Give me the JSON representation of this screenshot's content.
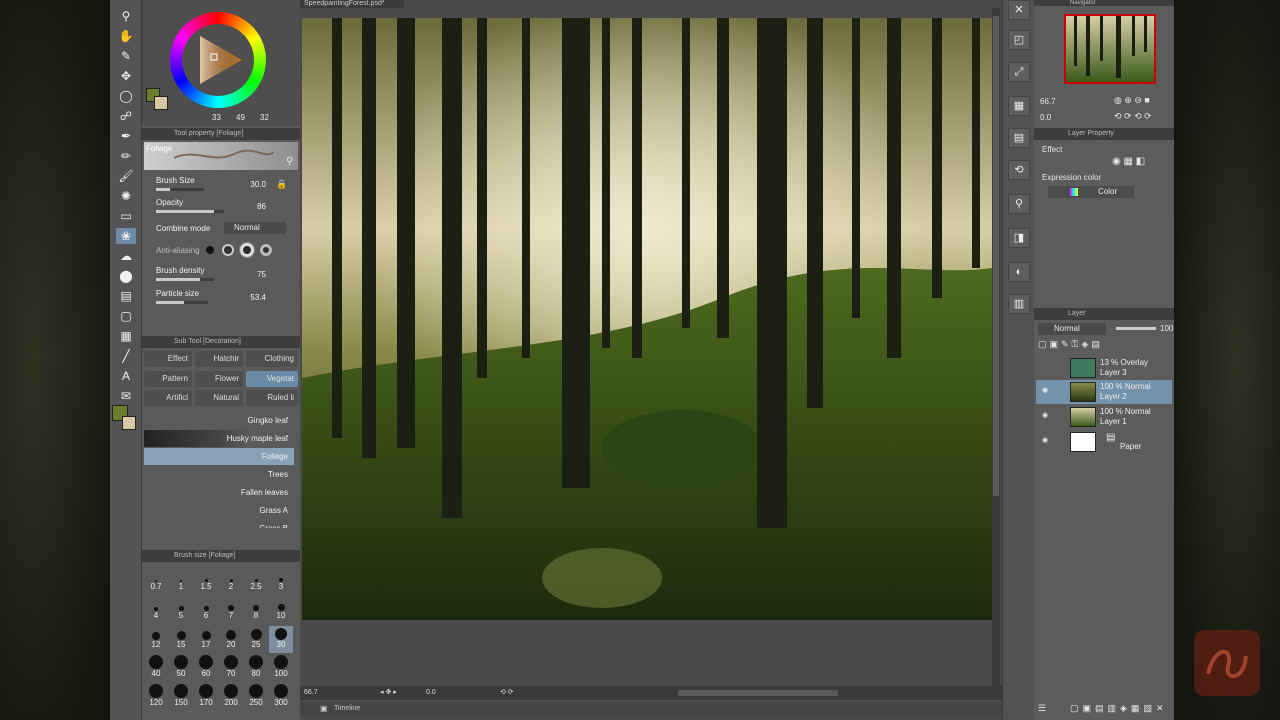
{
  "document": {
    "tab_title": "SpeedpaintingForest.psd*"
  },
  "color": {
    "main": "#6b7c2e",
    "sub": "#d9c9a3",
    "hue_label": "33",
    "sat_label": "49",
    "val_label": "32",
    "accent": "#6e8aa6"
  },
  "tool_property": {
    "header": "Tool property [Foliage]",
    "brush_name": "Foliage",
    "brush_size": {
      "label": "Brush Size",
      "value": "30.0",
      "level": 0.3
    },
    "opacity": {
      "label": "Opacity",
      "value": "86",
      "level": 0.86
    },
    "combine_mode": {
      "label": "Combine mode",
      "value": "Normal"
    },
    "anti_aliasing": {
      "label": "Anti-aliasing"
    },
    "brush_density": {
      "label": "Brush density",
      "value": "75",
      "level": 0.75
    },
    "particle_size": {
      "label": "Particle size",
      "value": "53.4",
      "level": 0.53
    }
  },
  "sub_tool": {
    "header": "Sub Tool [Decoration]",
    "buttons": [
      "Effect",
      "Hatchir",
      "Clothing",
      "Pattern",
      "Flower",
      "Vegetat",
      "Artificl",
      "Natural",
      "Ruled li"
    ],
    "selected_button": "Vegetat",
    "brushes": [
      "Gingko leaf",
      "Husky maple leaf",
      "Foliage",
      "Trees",
      "Fallen leaves",
      "Grass A",
      "Grass B"
    ],
    "selected_brush": "Foliage"
  },
  "brush_size_palette": {
    "header": "Brush size [Foliage]",
    "sizes": [
      "0.7",
      "1",
      "1.5",
      "2",
      "2.5",
      "3",
      "4",
      "5",
      "6",
      "7",
      "8",
      "10",
      "12",
      "15",
      "17",
      "20",
      "25",
      "30",
      "40",
      "50",
      "60",
      "70",
      "80",
      "100",
      "120",
      "150",
      "170",
      "200",
      "250",
      "300"
    ],
    "selected": "30"
  },
  "status": {
    "zoom": "66.7",
    "angle": "0.0"
  },
  "timeline": {
    "label": "Timeline"
  },
  "navigator": {
    "header": "Navigator",
    "zoom": "66.7",
    "angle": "0.0"
  },
  "layer_property": {
    "header": "Layer Property",
    "effect_label": "Effect",
    "expression_color_label": "Expression color",
    "expression_color_value": "Color"
  },
  "layer_panel": {
    "header": "Layer",
    "blend_mode": "Normal",
    "opacity": "100",
    "layers": [
      {
        "line1": "13 % Overlay",
        "line2": "Layer 3",
        "color": "#3f7a60"
      },
      {
        "line1": "100 % Normal",
        "line2": "Layer 2",
        "color": "#3a5a22"
      },
      {
        "line1": "100 % Normal",
        "line2": "Layer 1",
        "color": "#6d7a3a"
      },
      {
        "line1": "",
        "line2": "Paper",
        "color": "#ffffff"
      }
    ],
    "selected": "Layer 2"
  }
}
